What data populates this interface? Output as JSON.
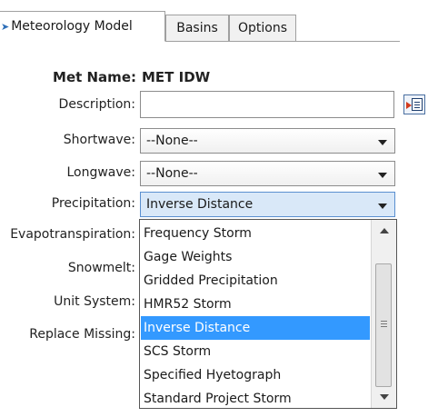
{
  "tabs": [
    {
      "label": "Meteorology Model",
      "icon": "meteorology-model-icon",
      "active": true
    },
    {
      "label": "Basins",
      "active": false
    },
    {
      "label": "Options",
      "active": false
    }
  ],
  "form": {
    "met_name_label": "Met Name:",
    "met_name_value": "MET IDW",
    "description_label": "Description:",
    "description_value": "",
    "shortwave_label": "Shortwave:",
    "shortwave_value": "--None--",
    "longwave_label": "Longwave:",
    "longwave_value": "--None--",
    "precipitation_label": "Precipitation:",
    "precipitation_value": "Inverse Distance",
    "evapotranspiration_label": "Evapotranspiration:",
    "snowmelt_label": "Snowmelt:",
    "unit_system_label": "Unit System:",
    "replace_missing_label": "Replace Missing:"
  },
  "precipitation_dropdown": {
    "options": [
      "Frequency Storm",
      "Gage Weights",
      "Gridded Precipitation",
      "HMR52 Storm",
      "Inverse Distance",
      "SCS Storm",
      "Specified Hyetograph",
      "Standard Project Storm"
    ],
    "selected": "Inverse Distance"
  },
  "colors": {
    "selection": "#3399ff",
    "combo_focus": "#d9e8f8"
  }
}
